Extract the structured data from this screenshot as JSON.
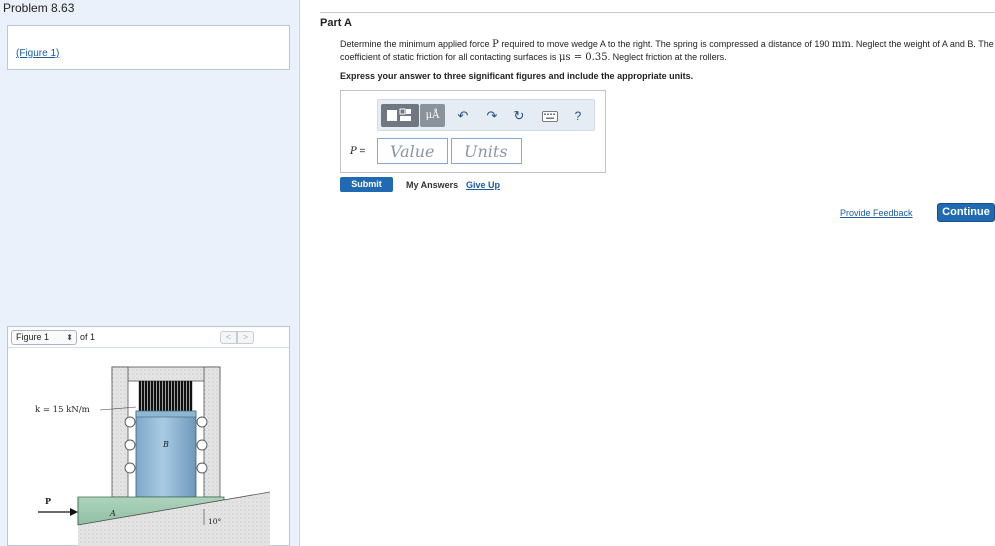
{
  "problem": {
    "title": "Problem 8.63",
    "figure_link": "(Figure 1)"
  },
  "part": {
    "title": "Part A",
    "text_1": "Determine the minimum applied force ",
    "text_force": "P",
    "text_2": " required to move wedge A to the right. The spring is compressed a distance of 190 ",
    "text_unit": "mm",
    "text_3": ". Neglect the weight of A and B. The coefficient of static friction for all contacting surfaces is ",
    "text_mu": "μs = 0.35",
    "text_4": ". Neglect friction at the rollers.",
    "instructions": "Express your answer to three significant figures and include the appropriate units."
  },
  "answer": {
    "variable": "P",
    "equals": "=",
    "value_placeholder": "Value",
    "units_placeholder": "Units",
    "units_button_label": "μÅ",
    "help_label": "?"
  },
  "actions": {
    "submit": "Submit",
    "my_answers": "My Answers",
    "give_up": "Give Up",
    "provide_feedback": "Provide Feedback",
    "continue": "Continue"
  },
  "figure_panel": {
    "selected": "Figure 1",
    "of_label": "of 1",
    "prev": "<",
    "next": ">",
    "labels": {
      "spring": "k = 15 kN/m",
      "block_b": "B",
      "wedge_a": "A",
      "force": "P",
      "angle": "10°"
    }
  },
  "colors": {
    "accent": "#1f6ab2",
    "link": "#1a5aa8",
    "left_bg": "#eaf1fb"
  }
}
